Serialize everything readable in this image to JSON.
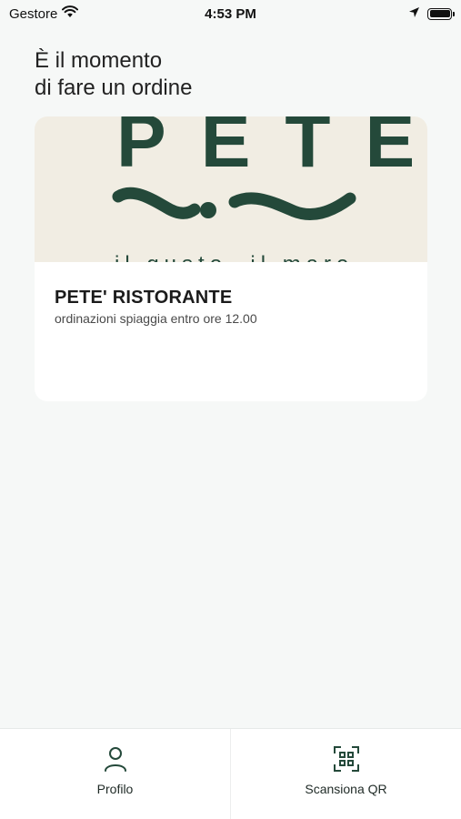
{
  "status_bar": {
    "carrier": "Gestore",
    "time": "4:53 PM",
    "icons": [
      "wifi-icon",
      "location-arrow-icon",
      "battery-icon"
    ]
  },
  "heading": {
    "line1": "È il momento",
    "line2": "di fare un ordine"
  },
  "restaurant_card": {
    "logo_text": "PETE",
    "logo_tagline": "il gusto, il mare",
    "name": "PETE' RISTORANTE",
    "description": "ordinazioni spiaggia entro ore 12.00"
  },
  "tab_bar": {
    "tabs": [
      {
        "label": "Profilo",
        "icon": "person-icon"
      },
      {
        "label": "Scansiona QR",
        "icon": "qr-scan-icon"
      }
    ]
  },
  "colors": {
    "background": "#f6f8f7",
    "brand_green": "#24493a",
    "logo_background": "#f1ede3",
    "card": "#ffffff"
  }
}
